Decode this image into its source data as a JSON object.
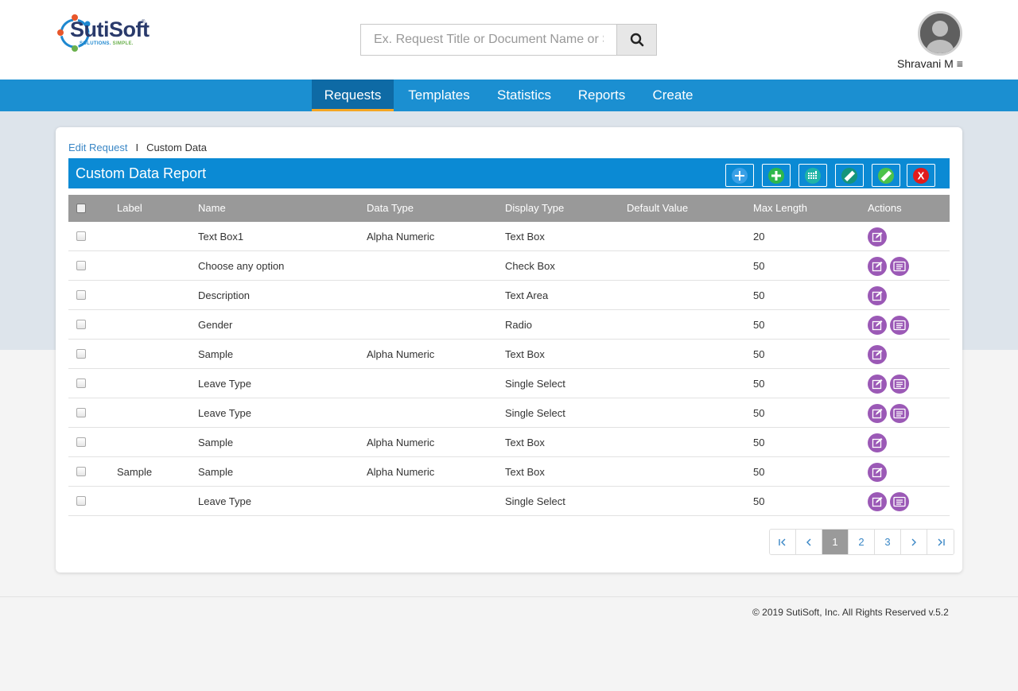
{
  "brand": {
    "name": "SutiSoft",
    "tagline_part1": "SOLUTIONS.",
    "tagline_part2": "SIMPLE.",
    "registered": "®",
    "colors": {
      "navy": "#2a3a6b",
      "blue": "#1e88d0",
      "green": "#6ab04c",
      "orange": "#e8562a"
    }
  },
  "search": {
    "placeholder": "Ex. Request Title or Document Name or S",
    "icon": "search-icon"
  },
  "user": {
    "name": "Shravani M",
    "menu_glyph": "≡"
  },
  "nav": {
    "items": [
      {
        "label": "Requests",
        "active": true
      },
      {
        "label": "Templates"
      },
      {
        "label": "Statistics"
      },
      {
        "label": "Reports"
      },
      {
        "label": "Create"
      }
    ]
  },
  "breadcrumb": {
    "link": "Edit Request",
    "separator": "I",
    "current": "Custom Data"
  },
  "panel": {
    "title": "Custom Data Report",
    "toolbar_icons": [
      "add-icon",
      "add-green-icon",
      "grid-icon",
      "ruler-icon",
      "ruler-green-icon",
      "close-icon"
    ],
    "close_glyph": "X"
  },
  "table": {
    "headers": {
      "label": "Label",
      "name": "Name",
      "data_type": "Data Type",
      "display_type": "Display Type",
      "default_value": "Default Value",
      "max_length": "Max Length",
      "actions": "Actions"
    },
    "rows": [
      {
        "label": "",
        "name": "Text Box1",
        "data_type": "Alpha Numeric",
        "display_type": "Text Box",
        "default_value": "",
        "max_length": "20",
        "actions": [
          "edit"
        ]
      },
      {
        "label": "",
        "name": "Choose any option",
        "data_type": "",
        "display_type": "Check Box",
        "default_value": "",
        "max_length": "50",
        "actions": [
          "edit",
          "options"
        ]
      },
      {
        "label": "",
        "name": "Description",
        "data_type": "",
        "display_type": "Text Area",
        "default_value": "",
        "max_length": "50",
        "actions": [
          "edit"
        ]
      },
      {
        "label": "",
        "name": "Gender",
        "data_type": "",
        "display_type": "Radio",
        "default_value": "",
        "max_length": "50",
        "actions": [
          "edit",
          "options"
        ]
      },
      {
        "label": "",
        "name": "Sample",
        "data_type": "Alpha Numeric",
        "display_type": "Text Box",
        "default_value": "",
        "max_length": "50",
        "actions": [
          "edit"
        ]
      },
      {
        "label": "",
        "name": "Leave Type",
        "data_type": "",
        "display_type": "Single Select",
        "default_value": "",
        "max_length": "50",
        "actions": [
          "edit",
          "options"
        ]
      },
      {
        "label": "",
        "name": "Leave Type",
        "data_type": "",
        "display_type": "Single Select",
        "default_value": "",
        "max_length": "50",
        "actions": [
          "edit",
          "options"
        ]
      },
      {
        "label": "",
        "name": "Sample",
        "data_type": "Alpha Numeric",
        "display_type": "Text Box",
        "default_value": "",
        "max_length": "50",
        "actions": [
          "edit"
        ]
      },
      {
        "label": "Sample",
        "name": "Sample",
        "data_type": "Alpha Numeric",
        "display_type": "Text Box",
        "default_value": "",
        "max_length": "50",
        "actions": [
          "edit"
        ]
      },
      {
        "label": "",
        "name": "Leave Type",
        "data_type": "",
        "display_type": "Single Select",
        "default_value": "",
        "max_length": "50",
        "actions": [
          "edit",
          "options"
        ]
      }
    ]
  },
  "pagination": {
    "pages": [
      "1",
      "2",
      "3"
    ],
    "current": "1",
    "icons": [
      "first-page-icon",
      "prev-page-icon",
      "next-page-icon",
      "last-page-icon"
    ]
  },
  "footer": {
    "text": "© 2019 SutiSoft, Inc. All Rights Reserved v.5.2"
  }
}
